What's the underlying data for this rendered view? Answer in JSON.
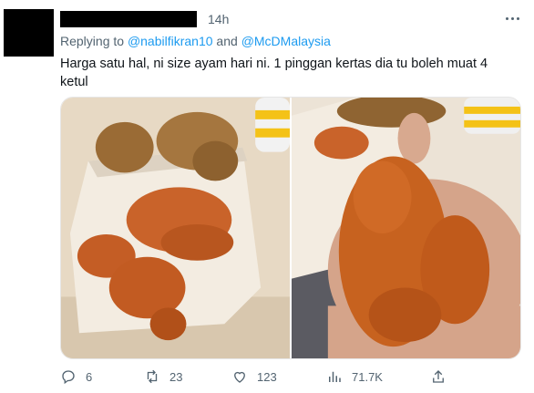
{
  "tweet": {
    "time": "14h",
    "replying": {
      "prefix": "Replying to ",
      "user1": "@nabilfikran10",
      "joiner": " and ",
      "user2": "@McDMalaysia"
    },
    "text": "Harga satu hal, ni size ayam hari ni. 1 pinggan kertas dia tu boleh muat 4 ketul"
  },
  "actions": {
    "replies": "6",
    "retweets": "23",
    "likes": "123",
    "views": "71.7K"
  },
  "icons": [
    "more-icon",
    "reply-icon",
    "retweet-icon",
    "like-icon",
    "views-icon",
    "share-icon"
  ],
  "colors": {
    "link": "#1d9bf0",
    "muted": "#536471",
    "text": "#0f1419"
  }
}
